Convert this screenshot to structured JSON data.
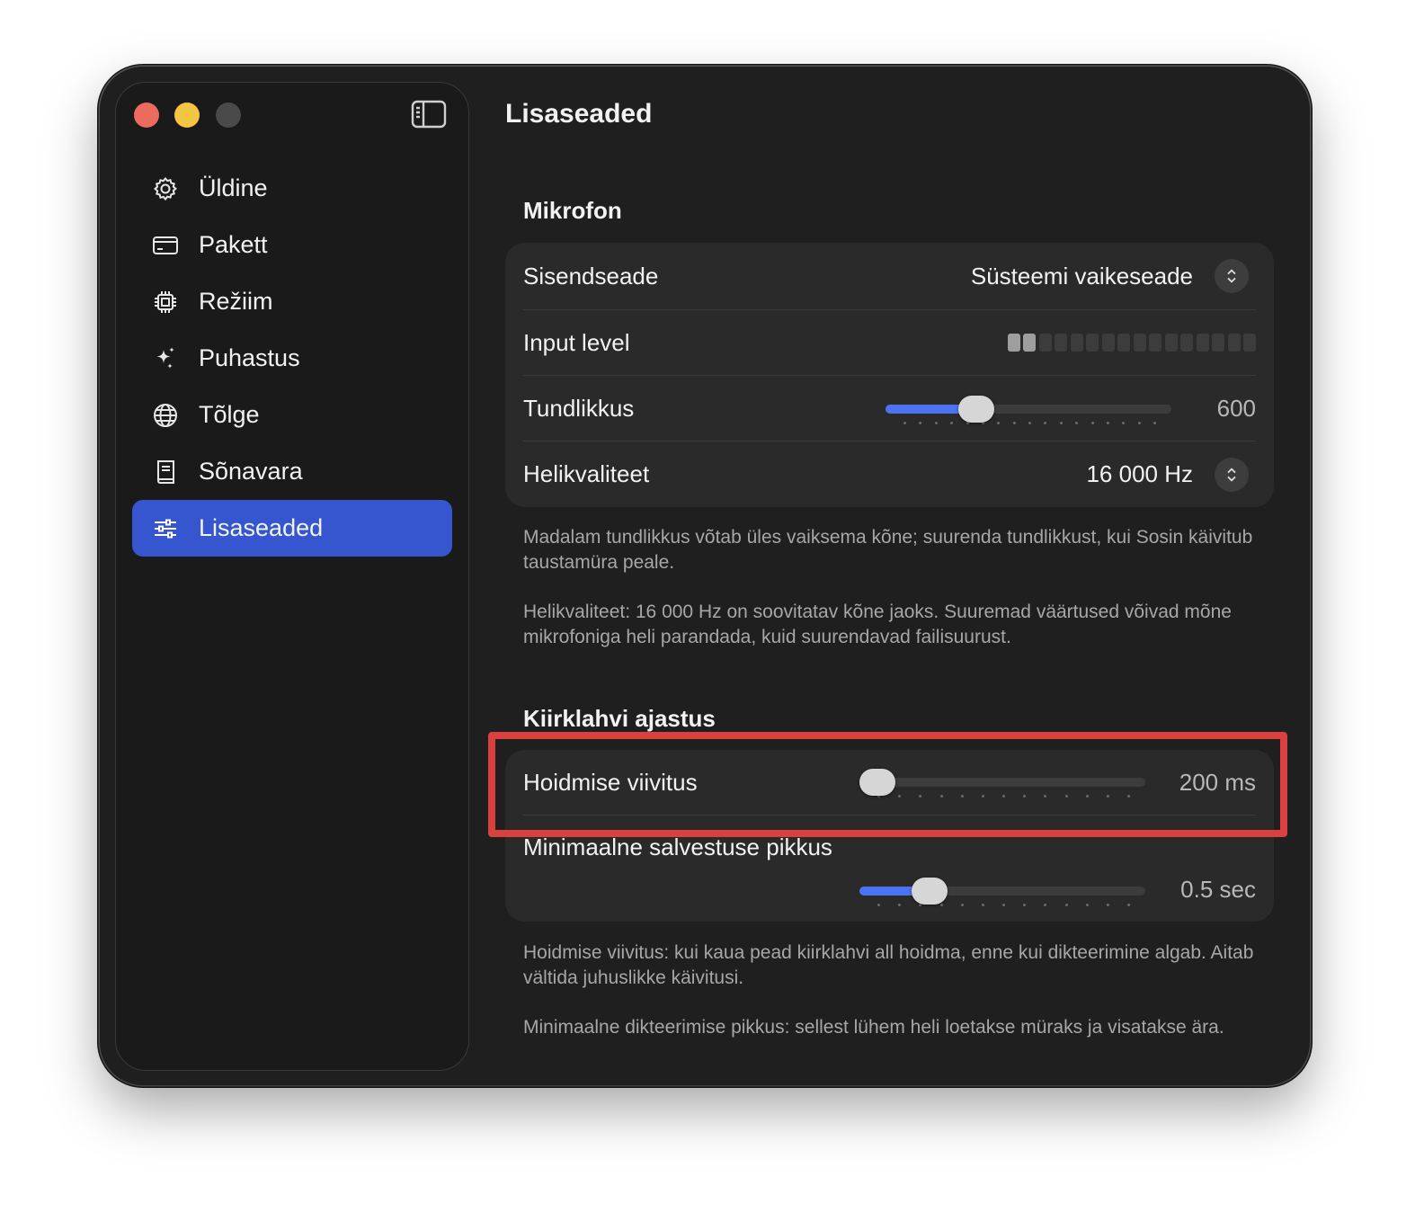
{
  "sidebar": {
    "items": [
      {
        "label": "Üldine",
        "icon": "gear-icon"
      },
      {
        "label": "Pakett",
        "icon": "credit-card-icon"
      },
      {
        "label": "Režiim",
        "icon": "chip-icon"
      },
      {
        "label": "Puhastus",
        "icon": "sparkles-icon"
      },
      {
        "label": "Tõlge",
        "icon": "globe-icon"
      },
      {
        "label": "Sõnavara",
        "icon": "book-icon"
      },
      {
        "label": "Lisaseaded",
        "icon": "sliders-icon",
        "active": true
      }
    ]
  },
  "page": {
    "title": "Lisaseaded"
  },
  "mikrofon": {
    "title": "Mikrofon",
    "input_device": {
      "label": "Sisendseade",
      "value": "Süsteemi vaikeseade"
    },
    "input_level": {
      "label": "Input level",
      "segments": 16,
      "active_segments": 2
    },
    "sensitivity": {
      "label": "Tundlikkus",
      "value": "600",
      "fraction": 0.29
    },
    "quality": {
      "label": "Helikvaliteet",
      "value": "16 000 Hz"
    },
    "help1": "Madalam tundlikkus võtab üles vaiksema kõne; suurenda tundlikkust, kui Sosin käivitub taustamüra peale.",
    "help2": "Helikvaliteet: 16 000 Hz on soovitatav kõne jaoks. Suuremad väärtused võivad mõne mikrofoniga heli parandada, kuid suurendavad failisuurust."
  },
  "hotkey": {
    "title": "Kiirklahvi ajastus",
    "hold_delay": {
      "label": "Hoidmise viivitus",
      "value": "200 ms",
      "fraction": 0.0
    },
    "min_length": {
      "label": "Minimaalne salvestuse pikkus",
      "value": "0.5 sec",
      "fraction": 0.21
    },
    "help1": "Hoidmise viivitus: kui kaua pead kiirklahvi all hoidma, enne kui dikteerimine algab. Aitab vältida juhuslikke käivitusi.",
    "help2": "Minimaalne dikteerimise pikkus: sellest lühem heli loetakse müraks ja visatakse ära."
  },
  "colors": {
    "accent": "#3656d0",
    "slider_fill": "#4d74f0",
    "highlight": "#d9403e",
    "traffic_red": "#ec6a5e",
    "traffic_yellow": "#f4c542"
  }
}
